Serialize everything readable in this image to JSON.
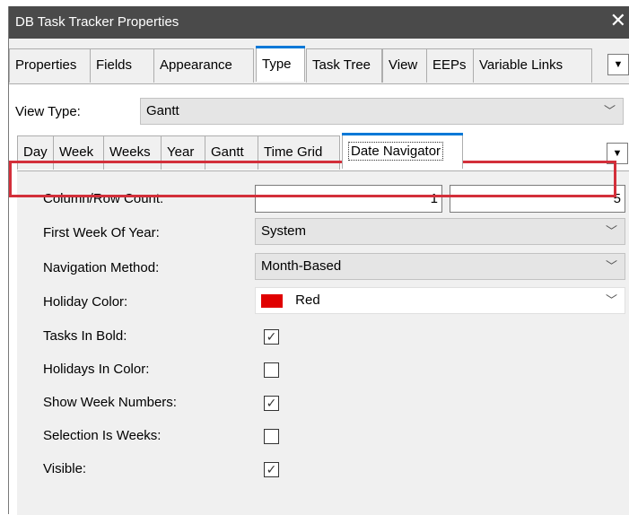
{
  "window": {
    "title": "DB Task Tracker  Properties",
    "close_label": "✕"
  },
  "main_tabs": [
    "Properties",
    "Fields",
    "Appearance",
    "Type",
    "Task Tree",
    "View",
    "EEPs",
    "Variable Links"
  ],
  "main_active_tab": "Type",
  "overflow_glyph": "▼",
  "view_type": {
    "label": "View Type:",
    "value": "Gantt"
  },
  "sub_tabs": [
    "Day",
    "Week",
    "Weeks",
    "Year",
    "Gantt",
    "Time Grid",
    "Date Navigator"
  ],
  "sub_active_tab": "Date Navigator",
  "chevron_glyph": "﹀",
  "check_glyph": "✓",
  "properties": {
    "column_row_count": {
      "label": "Column/Row Count:",
      "value1": "1",
      "value2": "5"
    },
    "first_week": {
      "label": "First Week Of Year:",
      "value": "System"
    },
    "navigation_method": {
      "label": "Navigation Method:",
      "value": "Month-Based"
    },
    "holiday_color": {
      "label": "Holiday Color:",
      "value": "Red",
      "swatch": "#e00000"
    },
    "tasks_in_bold": {
      "label": "Tasks In Bold:",
      "checked": true
    },
    "holidays_in_color": {
      "label": "Holidays In Color:",
      "checked": false
    },
    "show_week_numbers": {
      "label": "Show Week Numbers:",
      "checked": true
    },
    "selection_is_weeks": {
      "label": "Selection Is Weeks:",
      "checked": false
    },
    "visible": {
      "label": "Visible:",
      "checked": true
    }
  },
  "colors": {
    "titlebar": "#4a4a4a",
    "accent": "#0078d7",
    "highlight": "#d32f3a"
  }
}
